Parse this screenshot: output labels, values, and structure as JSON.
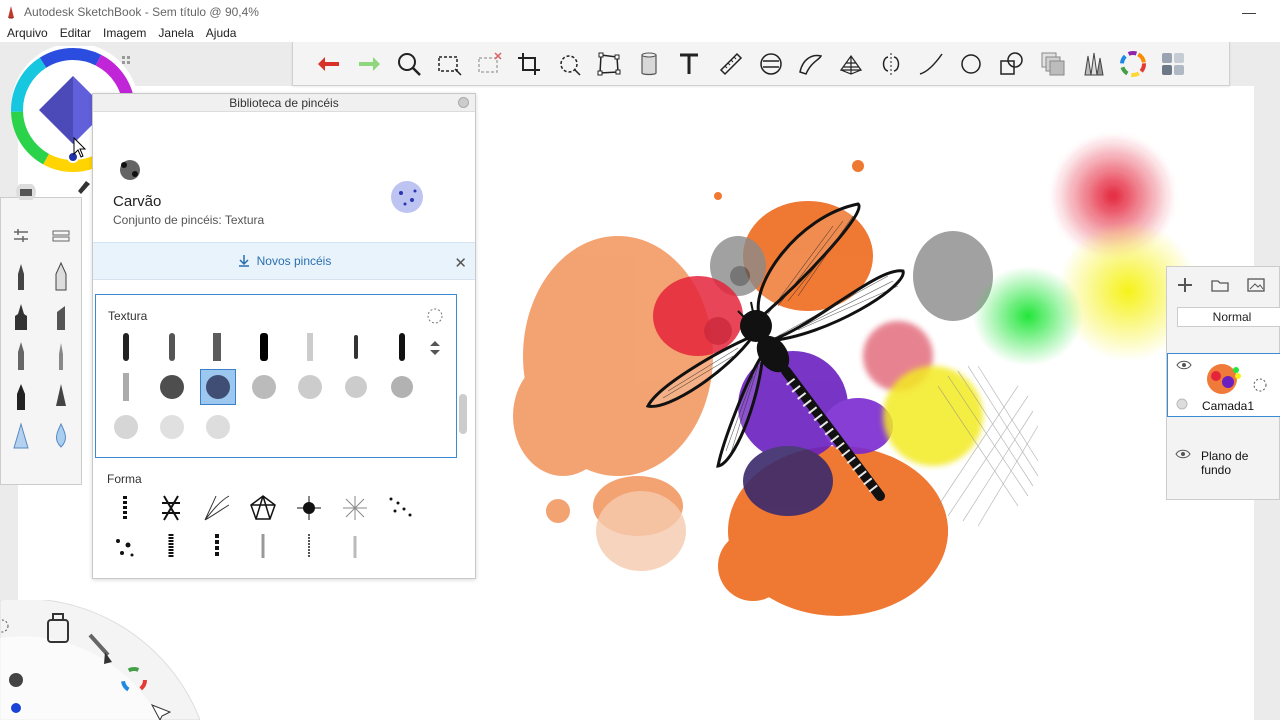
{
  "window": {
    "title": "Autodesk SketchBook - Sem título @ 90,4%",
    "minimize": "—"
  },
  "menu": [
    "Arquivo",
    "Editar",
    "Imagem",
    "Janela",
    "Ajuda"
  ],
  "library": {
    "header": "Biblioteca de pincéis",
    "brush_name": "Carvão",
    "brush_set": "Conjunto de pincéis: Textura",
    "new_brushes": "Novos pincéis",
    "sets": [
      {
        "title": "Textura"
      },
      {
        "title": "Forma"
      }
    ]
  },
  "layers": {
    "blend_mode": "Normal",
    "items": [
      {
        "name": "Camada1"
      },
      {
        "name": "Plano de fundo"
      }
    ]
  },
  "colors": {
    "accent": "#3a8ad6",
    "undo": "#d9302a",
    "redo": "#7ccf6a"
  }
}
